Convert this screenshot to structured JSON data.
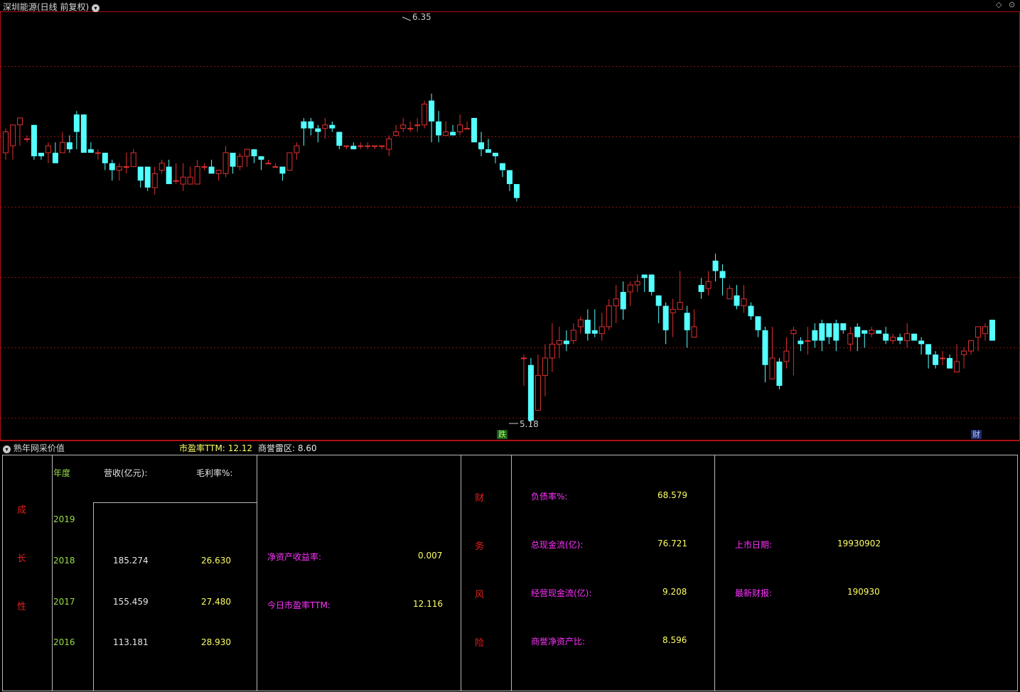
{
  "chart": {
    "title": "深圳能源(日线 前复权)",
    "high_label": "6.35",
    "low_label": "5.18",
    "event_badge_1": "跌",
    "event_badge_2": "财",
    "right_icon_1": "◇",
    "right_icon_2": "⊙"
  },
  "chart_data": {
    "type": "candlestick",
    "high": 6.35,
    "low": 5.18,
    "candles": [
      [
        5.96,
        6.02,
        5.94,
        6.03
      ],
      [
        5.98,
        6.04,
        5.94,
        6.04
      ],
      [
        6.04,
        6.06,
        5.98,
        6.04
      ],
      [
        6.0,
        6.0,
        5.99,
        6.01
      ],
      [
        6.04,
        5.95,
        5.94,
        6.04
      ],
      [
        5.96,
        5.95,
        5.94,
        5.96
      ],
      [
        5.96,
        5.98,
        5.93,
        5.99
      ],
      [
        5.96,
        5.93,
        5.93,
        5.99
      ],
      [
        5.96,
        5.99,
        5.97,
        6.02
      ],
      [
        5.99,
        5.97,
        5.96,
        6.01
      ],
      [
        6.07,
        6.02,
        5.97,
        6.08
      ],
      [
        6.07,
        5.96,
        5.96,
        6.07
      ],
      [
        5.97,
        5.96,
        5.97,
        5.99
      ],
      [
        5.96,
        5.96,
        5.94,
        5.97
      ],
      [
        5.96,
        5.93,
        5.91,
        5.96
      ],
      [
        5.93,
        5.91,
        5.88,
        5.94
      ],
      [
        5.91,
        5.92,
        5.88,
        5.93
      ],
      [
        5.92,
        5.92,
        5.9,
        5.96
      ],
      [
        5.92,
        5.96,
        5.94,
        5.97
      ],
      [
        5.92,
        5.88,
        5.86,
        5.92
      ],
      [
        5.92,
        5.86,
        5.85,
        5.92
      ],
      [
        5.86,
        5.9,
        5.84,
        5.92
      ],
      [
        5.91,
        5.93,
        5.9,
        5.94
      ],
      [
        5.92,
        5.87,
        5.87,
        5.94
      ],
      [
        5.88,
        5.88,
        5.87,
        5.93
      ],
      [
        5.87,
        5.89,
        5.85,
        5.93
      ],
      [
        5.87,
        5.89,
        5.87,
        5.92
      ],
      [
        5.87,
        5.92,
        5.87,
        5.94
      ],
      [
        5.92,
        5.92,
        5.91,
        5.93
      ],
      [
        5.92,
        5.9,
        5.9,
        5.94
      ],
      [
        5.9,
        5.91,
        5.88,
        5.91
      ],
      [
        5.9,
        5.96,
        5.89,
        5.98
      ],
      [
        5.96,
        5.92,
        5.9,
        5.96
      ],
      [
        5.92,
        5.95,
        5.91,
        5.96
      ],
      [
        5.95,
        5.97,
        5.92,
        5.97
      ],
      [
        5.97,
        5.95,
        5.93,
        5.97
      ],
      [
        5.95,
        5.94,
        5.91,
        5.95
      ],
      [
        5.93,
        5.93,
        5.93,
        5.94
      ],
      [
        5.92,
        5.92,
        5.92,
        5.93
      ],
      [
        5.92,
        5.9,
        5.88,
        5.92
      ],
      [
        5.91,
        5.96,
        5.91,
        5.96
      ],
      [
        5.96,
        5.98,
        5.94,
        5.99
      ],
      [
        6.05,
        6.03,
        5.98,
        6.06
      ],
      [
        6.05,
        6.03,
        6.01,
        6.06
      ],
      [
        6.03,
        6.02,
        5.99,
        6.04
      ],
      [
        6.03,
        6.04,
        6.0,
        6.06
      ],
      [
        6.04,
        6.03,
        6.02,
        6.05
      ],
      [
        6.02,
        5.98,
        5.97,
        6.02
      ],
      [
        5.98,
        5.98,
        5.97,
        5.98
      ],
      [
        5.98,
        5.97,
        5.97,
        5.99
      ],
      [
        5.98,
        5.98,
        5.97,
        5.99
      ],
      [
        5.98,
        5.98,
        5.97,
        5.99
      ],
      [
        5.98,
        5.98,
        5.97,
        5.98
      ],
      [
        5.98,
        5.98,
        5.97,
        5.98
      ],
      [
        5.97,
        6.0,
        5.95,
        6.01
      ],
      [
        6.01,
        6.02,
        6.01,
        6.04
      ],
      [
        6.03,
        6.04,
        6.02,
        6.06
      ],
      [
        6.03,
        6.03,
        6.02,
        6.05
      ],
      [
        6.04,
        6.04,
        6.02,
        6.06
      ],
      [
        6.04,
        6.1,
        6.03,
        6.11
      ],
      [
        6.11,
        6.05,
        5.99,
        6.13
      ],
      [
        6.05,
        6.01,
        5.99,
        6.08
      ],
      [
        6.01,
        6.02,
        6.01,
        6.05
      ],
      [
        6.02,
        6.01,
        6.01,
        6.04
      ],
      [
        6.02,
        6.04,
        6.01,
        6.07
      ],
      [
        6.03,
        6.03,
        6.03,
        6.05
      ],
      [
        6.06,
        5.99,
        5.99,
        6.06
      ],
      [
        5.99,
        5.97,
        5.95,
        6.02
      ],
      [
        5.97,
        5.96,
        5.96,
        6.0
      ],
      [
        5.96,
        5.95,
        5.93,
        5.96
      ],
      [
        5.93,
        5.91,
        5.89,
        5.93
      ],
      [
        5.91,
        5.87,
        5.85,
        5.91
      ],
      [
        5.87,
        5.83,
        5.82,
        5.87
      ],
      [
        5.37,
        5.37,
        5.29,
        5.38
      ],
      [
        5.35,
        5.19,
        5.18,
        5.37
      ],
      [
        5.22,
        5.32,
        5.22,
        5.38
      ],
      [
        5.32,
        5.37,
        5.26,
        5.41
      ],
      [
        5.37,
        5.41,
        5.33,
        5.47
      ],
      [
        5.41,
        5.42,
        5.37,
        5.46
      ],
      [
        5.42,
        5.41,
        5.39,
        5.45
      ],
      [
        5.42,
        5.45,
        5.41,
        5.47
      ],
      [
        5.46,
        5.48,
        5.44,
        5.49
      ],
      [
        5.48,
        5.44,
        5.42,
        5.51
      ],
      [
        5.45,
        5.44,
        5.43,
        5.51
      ],
      [
        5.44,
        5.46,
        5.42,
        5.5
      ],
      [
        5.46,
        5.52,
        5.45,
        5.54
      ],
      [
        5.52,
        5.54,
        5.47,
        5.58
      ],
      [
        5.56,
        5.51,
        5.48,
        5.59
      ],
      [
        5.56,
        5.58,
        5.52,
        5.59
      ],
      [
        5.58,
        5.59,
        5.56,
        5.61
      ],
      [
        5.61,
        5.6,
        5.56,
        5.6
      ],
      [
        5.61,
        5.56,
        5.55,
        5.61
      ],
      [
        5.55,
        5.52,
        5.47,
        5.55
      ],
      [
        5.52,
        5.45,
        5.41,
        5.53
      ],
      [
        5.5,
        5.51,
        5.43,
        5.54
      ],
      [
        5.51,
        5.53,
        5.51,
        5.62
      ],
      [
        5.5,
        5.45,
        5.4,
        5.52
      ],
      [
        5.43,
        5.46,
        5.44,
        5.51
      ],
      [
        5.58,
        5.56,
        5.54,
        5.6
      ],
      [
        5.57,
        5.59,
        5.55,
        5.62
      ],
      [
        5.65,
        5.62,
        5.59,
        5.67
      ],
      [
        5.62,
        5.6,
        5.55,
        5.64
      ],
      [
        5.54,
        5.57,
        5.55,
        5.58
      ],
      [
        5.55,
        5.52,
        5.51,
        5.58
      ],
      [
        5.52,
        5.54,
        5.5,
        5.58
      ],
      [
        5.52,
        5.49,
        5.48,
        5.53
      ],
      [
        5.49,
        5.45,
        5.43,
        5.49
      ],
      [
        5.45,
        5.35,
        5.3,
        5.46
      ],
      [
        5.31,
        5.37,
        5.34,
        5.46
      ],
      [
        5.36,
        5.29,
        5.28,
        5.37
      ],
      [
        5.36,
        5.39,
        5.34,
        5.43
      ],
      [
        5.44,
        5.45,
        5.32,
        5.46
      ],
      [
        5.42,
        5.41,
        5.39,
        5.43
      ],
      [
        5.42,
        5.42,
        5.38,
        5.46
      ],
      [
        5.45,
        5.42,
        5.4,
        5.47
      ],
      [
        5.47,
        5.42,
        5.39,
        5.48
      ],
      [
        5.47,
        5.43,
        5.41,
        5.46
      ],
      [
        5.47,
        5.42,
        5.39,
        5.48
      ],
      [
        5.47,
        5.45,
        5.44,
        5.47
      ],
      [
        5.41,
        5.44,
        5.39,
        5.46
      ],
      [
        5.46,
        5.43,
        5.39,
        5.47
      ],
      [
        5.45,
        5.44,
        5.4,
        5.45
      ],
      [
        5.44,
        5.45,
        5.43,
        5.46
      ],
      [
        5.45,
        5.44,
        5.44,
        5.45
      ],
      [
        5.44,
        5.42,
        5.41,
        5.46
      ],
      [
        5.42,
        5.43,
        5.41,
        5.44
      ],
      [
        5.43,
        5.42,
        5.41,
        5.44
      ],
      [
        5.42,
        5.44,
        5.4,
        5.47
      ],
      [
        5.44,
        5.42,
        5.42,
        5.44
      ],
      [
        5.42,
        5.41,
        5.38,
        5.43
      ],
      [
        5.41,
        5.38,
        5.34,
        5.41
      ],
      [
        5.38,
        5.35,
        5.34,
        5.39
      ],
      [
        5.37,
        5.37,
        5.35,
        5.39
      ],
      [
        5.37,
        5.34,
        5.34,
        5.38
      ],
      [
        5.33,
        5.36,
        5.34,
        5.41
      ],
      [
        5.38,
        5.39,
        5.34,
        5.4
      ],
      [
        5.39,
        5.42,
        5.38,
        5.42
      ],
      [
        5.43,
        5.46,
        5.39,
        5.46
      ],
      [
        5.44,
        5.46,
        5.42,
        5.47
      ],
      [
        5.48,
        5.42,
        5.45,
        5.48
      ]
    ]
  },
  "indicator_bar": {
    "title": "熟年网采价值",
    "pe_label": "市盈率TTM:",
    "pe_value": "12.12",
    "goodwill_label": "商誉雷区:",
    "goodwill_value": "8.60"
  },
  "table": {
    "growth_chars": [
      "成",
      "长",
      "性"
    ],
    "header_year": "年度",
    "header_revenue": "营收(亿元):",
    "header_margin": "毛利率%:",
    "rows": [
      {
        "year": "2019",
        "revenue": "",
        "margin": ""
      },
      {
        "year": "2018",
        "revenue": "185.274",
        "margin": "26.630"
      },
      {
        "year": "2017",
        "revenue": "155.459",
        "margin": "27.480"
      },
      {
        "year": "2016",
        "revenue": "113.181",
        "margin": "28.930"
      }
    ],
    "roe_label": "净资产收益率:",
    "roe_value": "0.007",
    "pe_today_label": "今日市盈率TTM:",
    "pe_today_value": "12.116",
    "risk_chars": [
      "财",
      "务",
      "风",
      "险"
    ],
    "debt_label": "负债率%:",
    "debt_value": "68.579",
    "cash_label": "总现金流(亿):",
    "cash_value": "76.721",
    "op_cash_label": "经营现金流(亿):",
    "op_cash_value": "9.208",
    "goodwill_label": "商誉净资产比:",
    "goodwill_value": "8.596",
    "listing_label": "上市日期:",
    "listing_value": "19930902",
    "report_label": "最新财报:",
    "report_value": "190930"
  }
}
